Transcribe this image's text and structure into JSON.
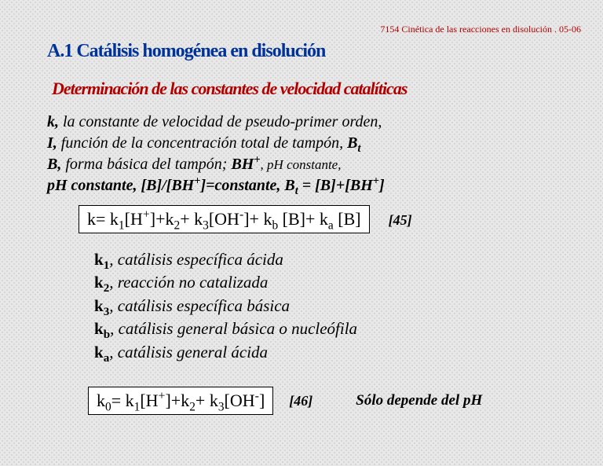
{
  "header": "7154 Cinética de las reacciones en disolución . 05-06",
  "title": "A.1 Catálisis homogénea en disolución",
  "subtitle": "Determinación de las constantes de velocidad catalíticas",
  "definitions": {
    "k_sym": "k,",
    "k_def": " la constante de velocidad de pseudo-primer orden,",
    "I_sym": "I,",
    "I_def": " función de la concentración total de tampón, ",
    "Bt_sym": "B",
    "Bt_sub": "t",
    "B_sym": "B,",
    "B_def": " forma básica del tampón; ",
    "BH_sym": "BH",
    "BH_sup": "+",
    "ph_const": ", pH constante,",
    "line4a": "pH constante, [B]/[BH",
    "line4b": "]=constante, B",
    "line4c": " = [B]+[BH",
    "line4d": "]"
  },
  "eq45": {
    "pre": "k= k",
    "s1": "1",
    "p1": "[H",
    "sup1": "+",
    "p2": "]+k",
    "s2": "2",
    "p3": "+ k",
    "s3": "3",
    "p4": "[OH",
    "sup2": "-",
    "p5": "]+ k",
    "sb": "b",
    "p6": " [B]+ k",
    "sa": "a",
    "p7": " [B]",
    "label": "[45]"
  },
  "klist": {
    "k1": "k",
    "k1s": "1",
    "k1d": ", catálisis específica ácida",
    "k2": "k",
    "k2s": "2",
    "k2d": ", reacción no catalizada",
    "k3": "k",
    "k3s": "3",
    "k3d": ", catálisis específica básica",
    "kb": "k",
    "kbs": "b",
    "kbd": ", catálisis general básica o nucleófila",
    "ka": "k",
    "kas": "a",
    "kad": ", catálisis general ácida"
  },
  "eq46": {
    "pre": "k",
    "s0": "0",
    "p0": "= k",
    "s1": "1",
    "p1": "[H",
    "sup1": "+",
    "p2": "]+k",
    "s2": "2",
    "p3": "+ k",
    "s3": "3",
    "p4": "[OH",
    "sup2": "-",
    "p5": "]",
    "label": "[46]"
  },
  "depends": "Sólo depende del pH"
}
